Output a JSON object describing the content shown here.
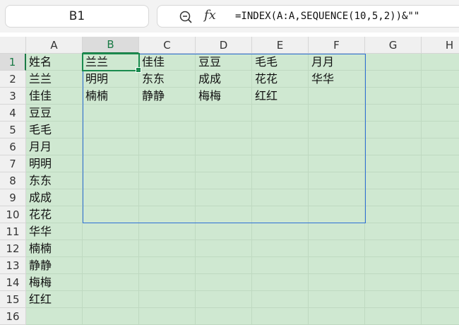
{
  "name_box": {
    "value": "B1"
  },
  "formula_bar": {
    "formula": "=INDEX(A:A,SEQUENCE(10,5,2))&\"\""
  },
  "sheet": {
    "columns": [
      "A",
      "B",
      "C",
      "D",
      "E",
      "F",
      "G",
      "H"
    ],
    "rows": [
      "1",
      "2",
      "3",
      "4",
      "5",
      "6",
      "7",
      "8",
      "9",
      "10",
      "11",
      "12",
      "13",
      "14",
      "15",
      "16"
    ],
    "active_column": "B",
    "active_row": "1",
    "cells": [
      [
        "姓名",
        "兰兰",
        "佳佳",
        "豆豆",
        "毛毛",
        "月月",
        "",
        ""
      ],
      [
        "兰兰",
        "明明",
        "东东",
        "成成",
        "花花",
        "华华",
        "",
        ""
      ],
      [
        "佳佳",
        "楠楠",
        "静静",
        "梅梅",
        "红红",
        "",
        "",
        ""
      ],
      [
        "豆豆",
        "",
        "",
        "",
        "",
        "",
        "",
        ""
      ],
      [
        "毛毛",
        "",
        "",
        "",
        "",
        "",
        "",
        ""
      ],
      [
        "月月",
        "",
        "",
        "",
        "",
        "",
        "",
        ""
      ],
      [
        "明明",
        "",
        "",
        "",
        "",
        "",
        "",
        ""
      ],
      [
        "东东",
        "",
        "",
        "",
        "",
        "",
        "",
        ""
      ],
      [
        "成成",
        "",
        "",
        "",
        "",
        "",
        "",
        ""
      ],
      [
        "花花",
        "",
        "",
        "",
        "",
        "",
        "",
        ""
      ],
      [
        "华华",
        "",
        "",
        "",
        "",
        "",
        "",
        ""
      ],
      [
        "楠楠",
        "",
        "",
        "",
        "",
        "",
        "",
        ""
      ],
      [
        "静静",
        "",
        "",
        "",
        "",
        "",
        "",
        ""
      ],
      [
        "梅梅",
        "",
        "",
        "",
        "",
        "",
        "",
        ""
      ],
      [
        "红红",
        "",
        "",
        "",
        "",
        "",
        "",
        ""
      ],
      [
        "",
        "",
        "",
        "",
        "",
        "",
        "",
        ""
      ]
    ]
  },
  "colors": {
    "cell_fill": "#cfe8d1",
    "accent": "#1a8a4e",
    "spill_border": "#2d6fd6"
  }
}
